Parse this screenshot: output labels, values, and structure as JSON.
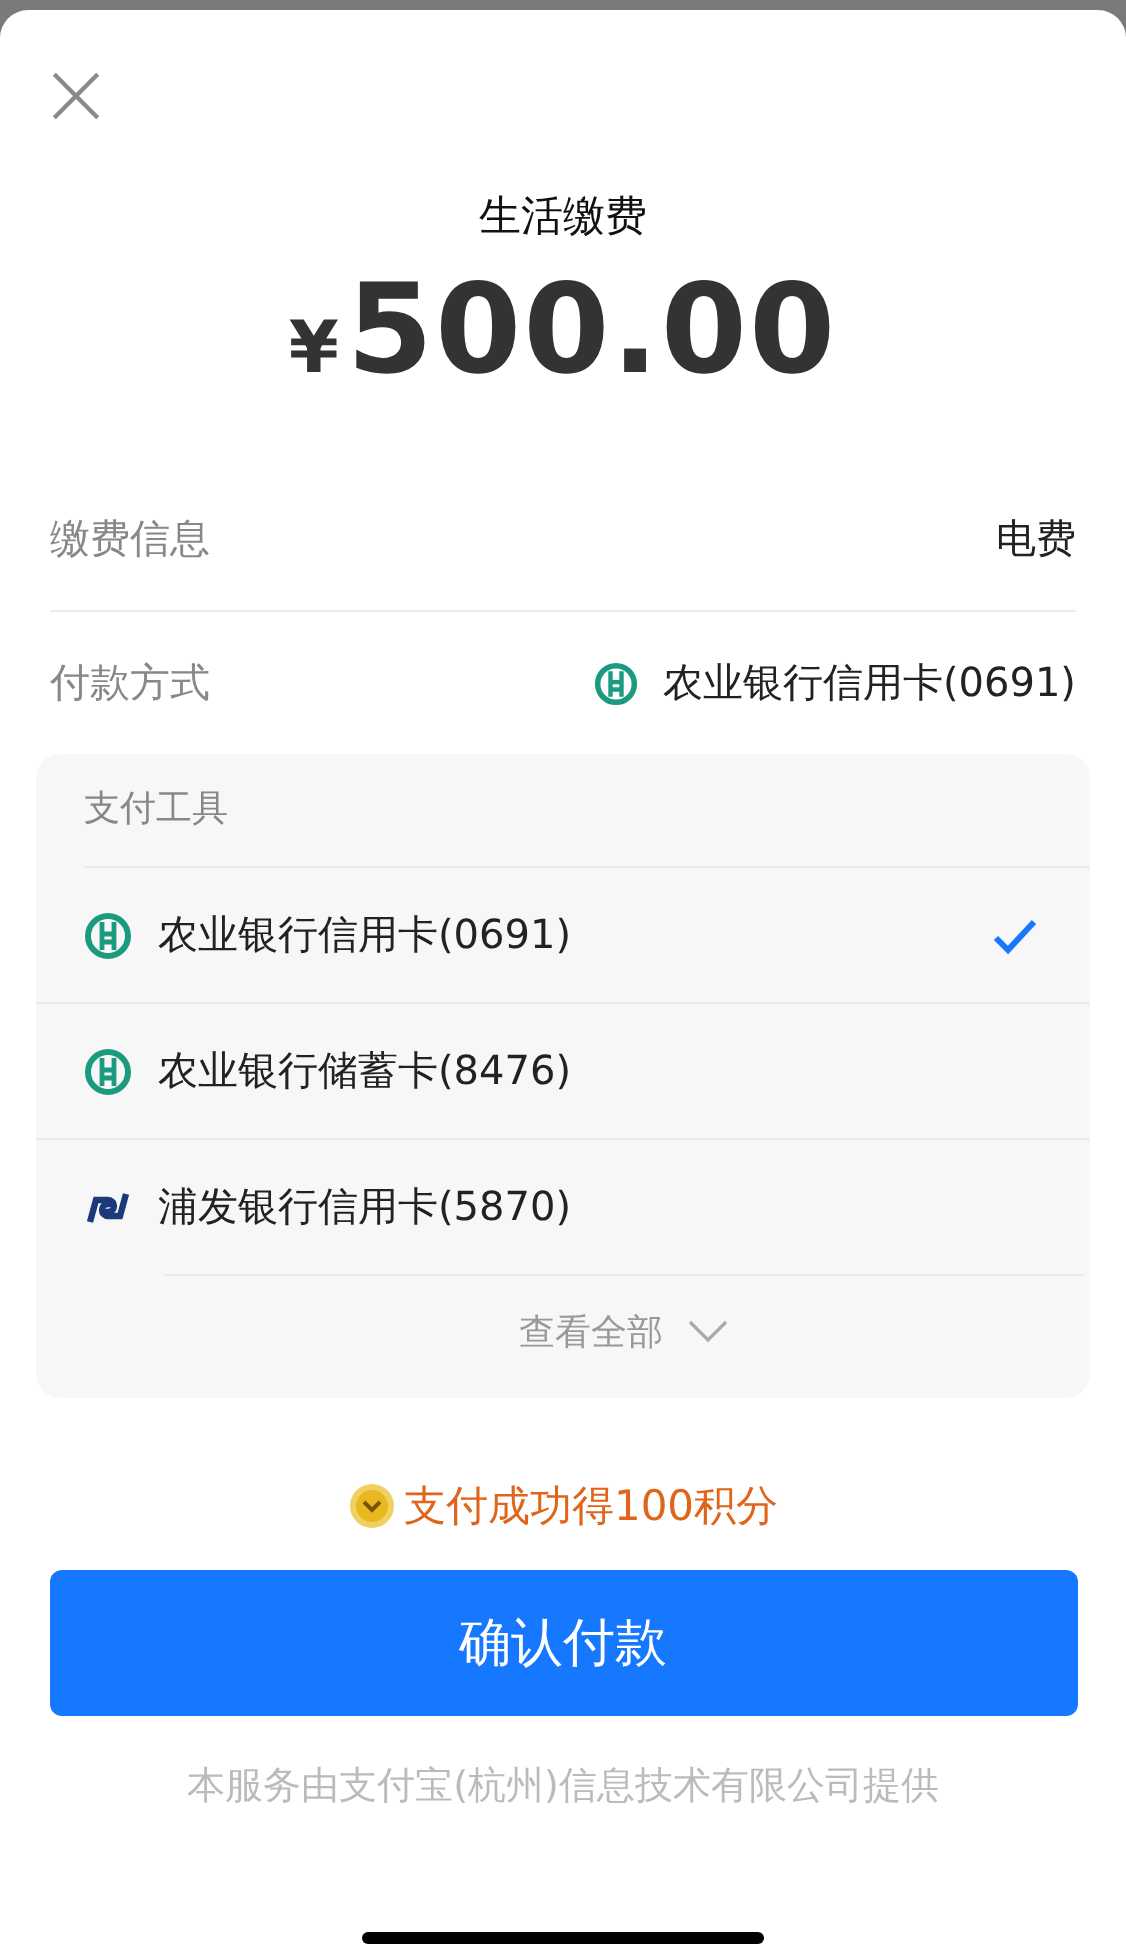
{
  "title": "生活缴费",
  "amount": {
    "currency": "¥",
    "value": "500.00"
  },
  "info_rows": [
    {
      "label": "缴费信息",
      "value": "电费"
    },
    {
      "label": "付款方式",
      "value": "农业银行信用卡(0691)",
      "kind": "abc"
    }
  ],
  "payment_tools": {
    "header": "支付工具",
    "items": [
      {
        "label": "农业银行信用卡(0691)",
        "kind": "abc",
        "selected": true
      },
      {
        "label": "农业银行储蓄卡(8476)",
        "kind": "abc",
        "selected": false
      },
      {
        "label": "浦发银行信用卡(5870)",
        "kind": "spdb",
        "selected": false
      }
    ],
    "show_all": "查看全部"
  },
  "reward": "支付成功得100积分",
  "confirm_button": "确认付款",
  "footer": "本服务由支付宝(杭州)信息技术有限公司提供"
}
